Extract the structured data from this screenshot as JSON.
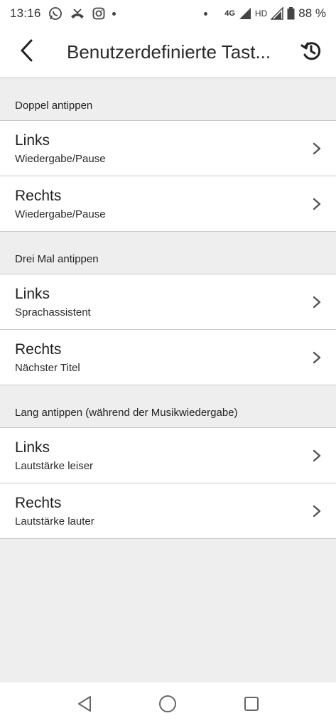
{
  "status_bar": {
    "time": "13:16",
    "network": "4G",
    "hd": "HD",
    "battery": "88 %"
  },
  "app_bar": {
    "title": "Benutzerdefinierte Tast..."
  },
  "sections": [
    {
      "header": "Doppel antippen",
      "rows": [
        {
          "title": "Links",
          "subtitle": "Wiedergabe/Pause"
        },
        {
          "title": "Rechts",
          "subtitle": "Wiedergabe/Pause"
        }
      ]
    },
    {
      "header": "Drei Mal antippen",
      "rows": [
        {
          "title": "Links",
          "subtitle": "Sprachassistent"
        },
        {
          "title": "Rechts",
          "subtitle": "Nächster Titel"
        }
      ]
    },
    {
      "header": "Lang antippen (während der Musikwiedergabe)",
      "rows": [
        {
          "title": "Links",
          "subtitle": "Lautstärke leiser"
        },
        {
          "title": "Rechts",
          "subtitle": "Lautstärke lauter"
        }
      ]
    }
  ]
}
